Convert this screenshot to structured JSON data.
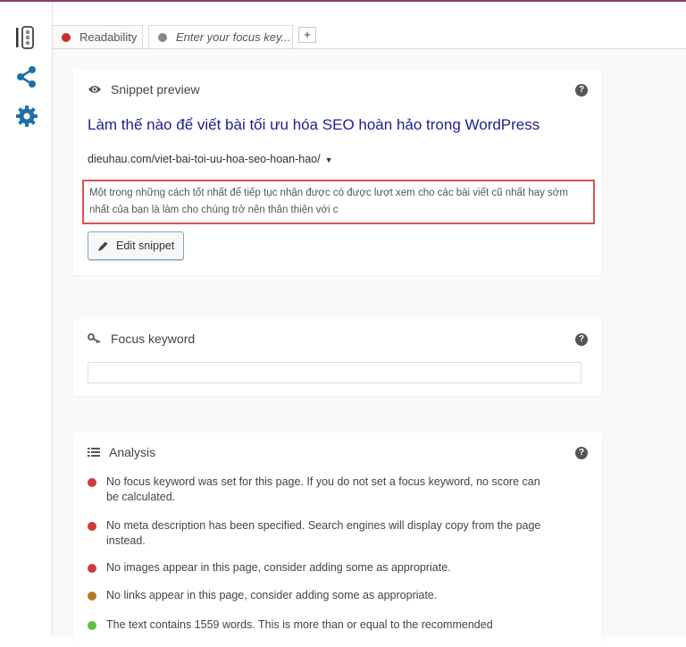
{
  "tabs": [
    {
      "label": "Readability",
      "dot_color": "#cc2b2b"
    },
    {
      "label": "Enter your focus key...",
      "dot_color": "#888888"
    }
  ],
  "add_tab_label": "+",
  "colors": {
    "accent_top": "#8a3d6e",
    "side_icon": "#1e6fa8",
    "link_title": "#1e1e8f",
    "highlight_border": "#d9534f"
  },
  "snippet": {
    "heading": "Snippet preview",
    "help": "?",
    "title": "Làm thế nào để viết bài tối ưu hóa SEO hoàn hảo trong WordPress",
    "url": "dieuhau.com/viet-bai-toi-uu-hoa-seo-hoan-hao/",
    "url_caret": "▼",
    "description": "Một trong những cách tốt nhất để tiếp tục nhận được có được lượt xem cho các bài viết cũ nhất hay sớm nhất của bạn là làm cho chúng trở nên thân thiện với c",
    "edit_label": "Edit snippet"
  },
  "focus": {
    "heading": "Focus keyword",
    "help": "?",
    "value": ""
  },
  "analysis": {
    "heading": "Analysis",
    "help": "?",
    "items": [
      {
        "text": "No focus keyword was set for this page. If you do not set a focus keyword, no score can be calculated.",
        "color": "#d13b3b"
      },
      {
        "text": "No meta description has been specified. Search engines will display copy from the page instead.",
        "color": "#d13b3b"
      },
      {
        "text": "No images appear in this page, consider adding some as appropriate.",
        "color": "#d13b3b"
      },
      {
        "text": "No links appear in this page, consider adding some as appropriate.",
        "color": "#b8762a"
      },
      {
        "text": "The text contains 1559 words. This is more than or equal to the recommended",
        "color": "#5cc13b"
      }
    ]
  }
}
